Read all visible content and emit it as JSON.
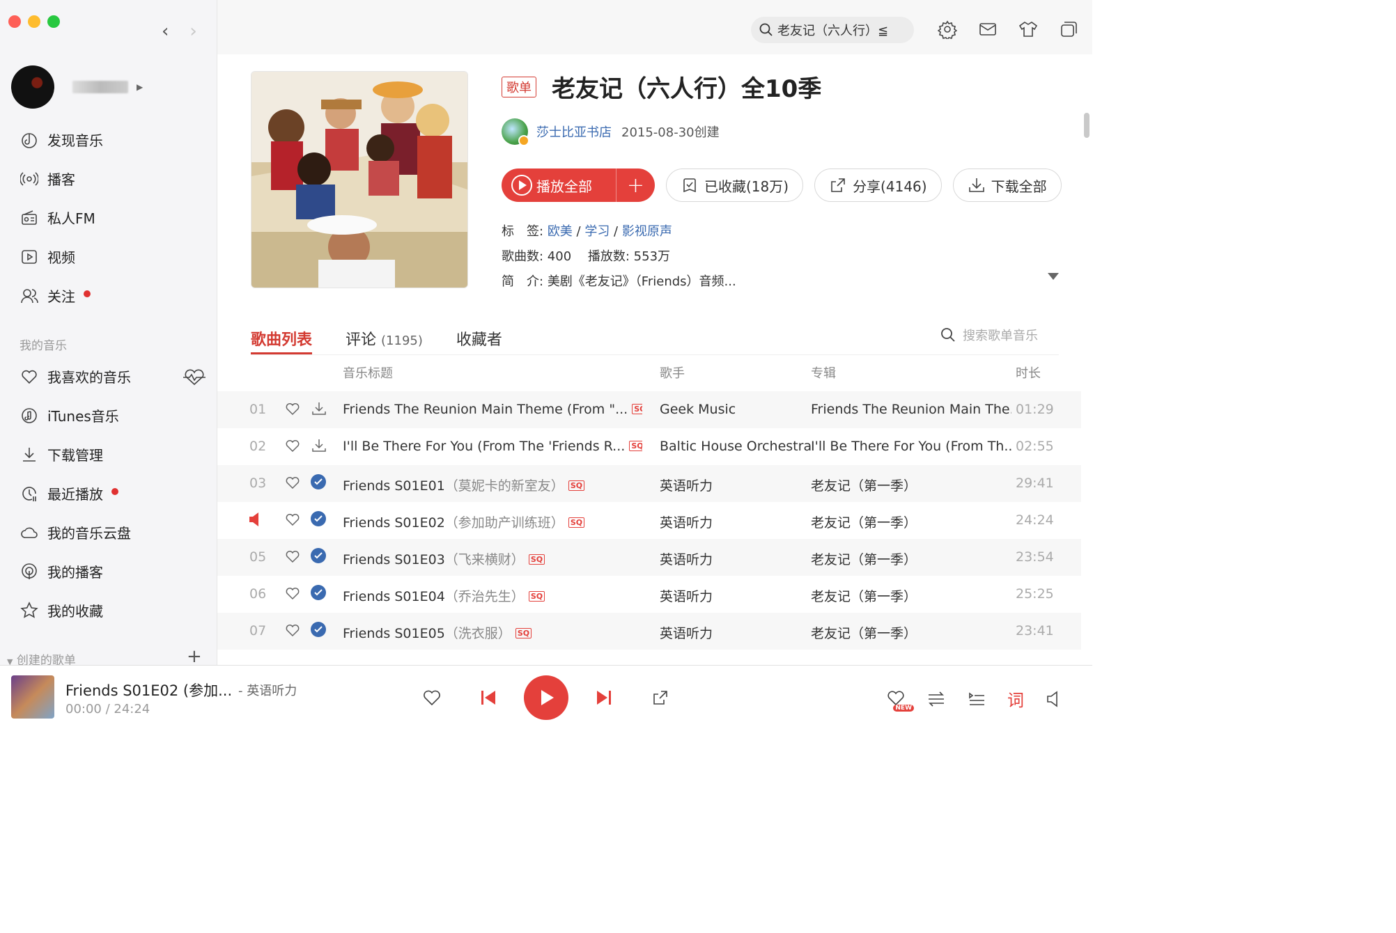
{
  "sidebar": {
    "nav": [
      {
        "label": "发现音乐",
        "icon": "music-note-icon"
      },
      {
        "label": "播客",
        "icon": "podcast-icon"
      },
      {
        "label": "私人FM",
        "icon": "radio-icon"
      },
      {
        "label": "视频",
        "icon": "video-icon"
      },
      {
        "label": "关注",
        "icon": "follow-icon"
      }
    ],
    "my_music_title": "我的音乐",
    "my_music": [
      {
        "label": "我喜欢的音乐",
        "icon": "heart-icon"
      },
      {
        "label": "iTunes音乐",
        "icon": "itunes-icon"
      },
      {
        "label": "下载管理",
        "icon": "download-icon"
      },
      {
        "label": "最近播放",
        "icon": "recent-icon"
      },
      {
        "label": "我的音乐云盘",
        "icon": "cloud-icon"
      },
      {
        "label": "我的播客",
        "icon": "my-podcast-icon"
      },
      {
        "label": "我的收藏",
        "icon": "star-icon"
      }
    ],
    "created_title": "创建的歌单"
  },
  "topbar": {
    "search_value": "老友记（六人行）≦"
  },
  "playlist": {
    "badge": "歌单",
    "title": "老友记（六人行）全10季",
    "creator": "莎士比亚书店",
    "created": "2015-08-30创建",
    "play_all": "播放全部",
    "collected": "已收藏(18万)",
    "share": "分享(4146)",
    "download_all": "下载全部",
    "tags_label": "标　签:",
    "tags": [
      "欧美",
      "学习",
      "影视原声"
    ],
    "song_count_label": "歌曲数: 400",
    "play_count_label": "播放数: 553万",
    "intro_label": "简　介:",
    "intro": "美剧《老友记》（Friends）音频..."
  },
  "tabs": {
    "songs": "歌曲列表",
    "comments": "评论",
    "comments_count": "(1195)",
    "collectors": "收藏者",
    "search_placeholder": "搜索歌单音乐"
  },
  "table": {
    "headers": {
      "title": "音乐标题",
      "artist": "歌手",
      "album": "专辑",
      "duration": "时长"
    },
    "rows": [
      {
        "num": "01",
        "title": "Friends The Reunion Main Theme (From \"...",
        "sub": "",
        "artist": "Geek Music",
        "album": "Friends The Reunion Main The...",
        "duration": "01:29",
        "downloaded": false
      },
      {
        "num": "02",
        "title": "I'll Be There For You (From The 'Friends R...",
        "sub": "",
        "artist": "Baltic House Orchestra",
        "album": "I'll Be There For You (From Th...",
        "duration": "02:55",
        "downloaded": false
      },
      {
        "num": "03",
        "title": "Friends S01E01",
        "sub": "（莫妮卡的新室友）",
        "artist": "英语听力",
        "album": "老友记（第一季）",
        "duration": "29:41",
        "downloaded": true
      },
      {
        "num": "",
        "title": "Friends S01E02",
        "sub": "（参加助产训练班）",
        "artist": "英语听力",
        "album": "老友记（第一季）",
        "duration": "24:24",
        "downloaded": true,
        "playing": true
      },
      {
        "num": "05",
        "title": "Friends S01E03",
        "sub": "（飞来横财）",
        "artist": "英语听力",
        "album": "老友记（第一季）",
        "duration": "23:54",
        "downloaded": true
      },
      {
        "num": "06",
        "title": "Friends S01E04",
        "sub": "（乔治先生）",
        "artist": "英语听力",
        "album": "老友记（第一季）",
        "duration": "25:25",
        "downloaded": true
      },
      {
        "num": "07",
        "title": "Friends S01E05",
        "sub": "（洗衣服）",
        "artist": "英语听力",
        "album": "老友记（第一季）",
        "duration": "23:41",
        "downloaded": true
      }
    ],
    "sq_label": "SQ"
  },
  "player": {
    "title": "Friends S01E02 (参加...",
    "artist": "- 英语听力",
    "current": "00:00",
    "total": "24:24",
    "lyric_label": "词",
    "new_badge": "NEW"
  },
  "colors": {
    "accent": "#e4403b",
    "link": "#3a6ab0"
  }
}
